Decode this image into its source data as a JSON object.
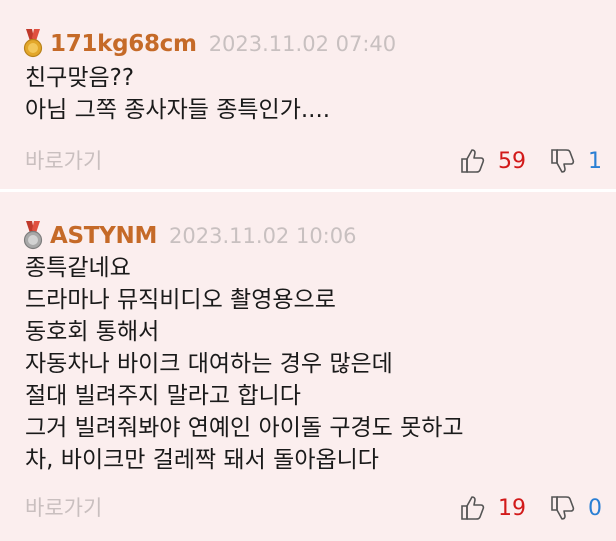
{
  "comments": [
    {
      "nickname": "171kg68cm",
      "date": "2023.11.02 07:40",
      "medal": "gold",
      "lines": [
        "친구맞음??",
        "아님 그쪽 종사자들 종특인가...."
      ],
      "reply_label": "바로가기",
      "upvotes": "59",
      "downvotes": "1"
    },
    {
      "nickname": "ASTYNM",
      "date": "2023.11.02 10:06",
      "medal": "silver",
      "lines": [
        "종특같네요",
        "드라마나 뮤직비디오 촬영용으로",
        "동호회 통해서",
        "자동차나 바이크 대여하는 경우 많은데",
        "절대 빌려주지 말라고 합니다",
        "그거 빌려줘봐야 연예인 아이돌 구경도 못하고",
        "차, 바이크만 걸레짝 돼서 돌아옵니다"
      ],
      "reply_label": "바로가기",
      "upvotes": "19",
      "downvotes": "0"
    }
  ],
  "colors": {
    "background": "#fbeeee",
    "nickname": "#c56a28",
    "date": "#c8c0c0",
    "upvote": "#d21a1a",
    "downvote": "#2a7fd4",
    "medal_gold": "#e3a72a",
    "medal_silver": "#a8a8a8",
    "ribbon": "#c0392b"
  },
  "icons": {
    "medal_gold": "gold-medal-icon",
    "medal_silver": "silver-medal-icon",
    "thumb_up": "thumbs-up-icon",
    "thumb_down": "thumbs-down-icon"
  }
}
